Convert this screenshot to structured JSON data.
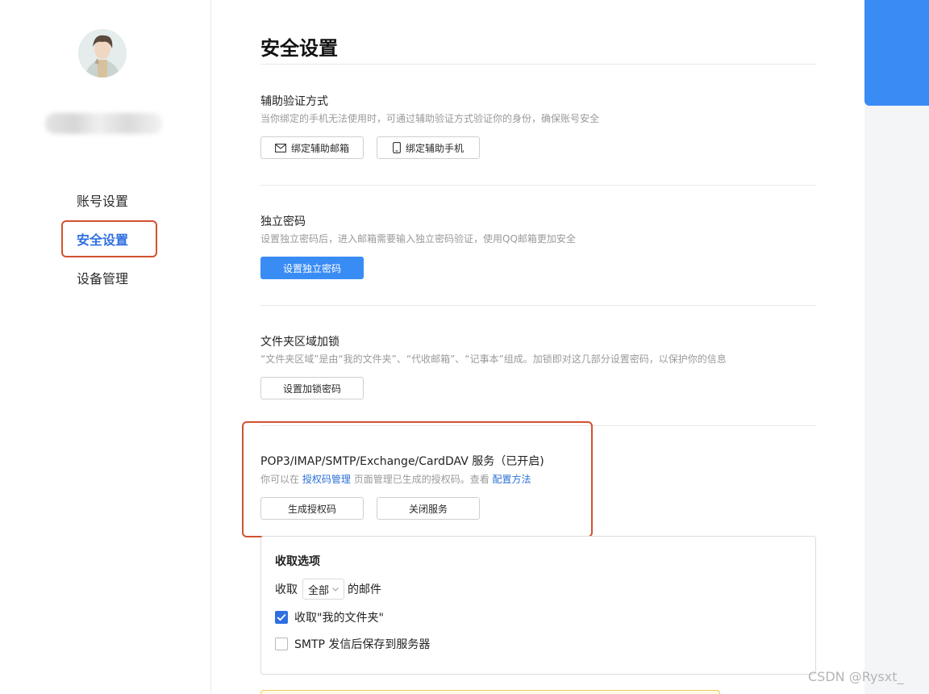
{
  "sidebar": {
    "avatar_label": "",
    "items": [
      {
        "label": "账号设置"
      },
      {
        "label": "安全设置"
      },
      {
        "label": "设备管理"
      }
    ]
  },
  "page": {
    "title": "安全设置"
  },
  "sections": {
    "aux_verify": {
      "title": "辅助验证方式",
      "desc": "当你绑定的手机无法使用时，可通过辅助验证方式验证你的身份，确保账号安全",
      "btn_email": "绑定辅助邮箱",
      "btn_phone": "绑定辅助手机"
    },
    "independent_pwd": {
      "title": "独立密码",
      "desc": "设置独立密码后，进入邮箱需要输入独立密码验证，使用QQ邮箱更加安全",
      "btn": "设置独立密码"
    },
    "folder_lock": {
      "title": "文件夹区域加锁",
      "desc": "“文件夹区域”是由“我的文件夹”、“代收邮箱”、“记事本”组成。加锁即对这几部分设置密码，以保护你的信息",
      "btn": "设置加锁密码"
    },
    "pop3": {
      "title": "POP3/IMAP/SMTP/Exchange/CardDAV 服务（已开启)",
      "desc_prefix": "你可以在",
      "desc_link1": "授权码管理",
      "desc_mid": "页面管理已生成的授权码。查看",
      "desc_link2": "配置方法",
      "btn_generate": "生成授权码",
      "btn_close": "关闭服务"
    }
  },
  "receive_options": {
    "title": "收取选项",
    "prefix": "收取",
    "select_value": "全部",
    "suffix": "的邮件",
    "opt1": {
      "label": "收取\"我的文件夹\"",
      "checked": true
    },
    "opt2": {
      "label": "SMTP 发信后保存到服务器",
      "checked": false
    }
  },
  "watermark": "CSDN @Rysxt_",
  "colors": {
    "accent": "#2f6fe0",
    "primary_button": "#3a8cf5",
    "highlight_border": "#d2512f"
  }
}
